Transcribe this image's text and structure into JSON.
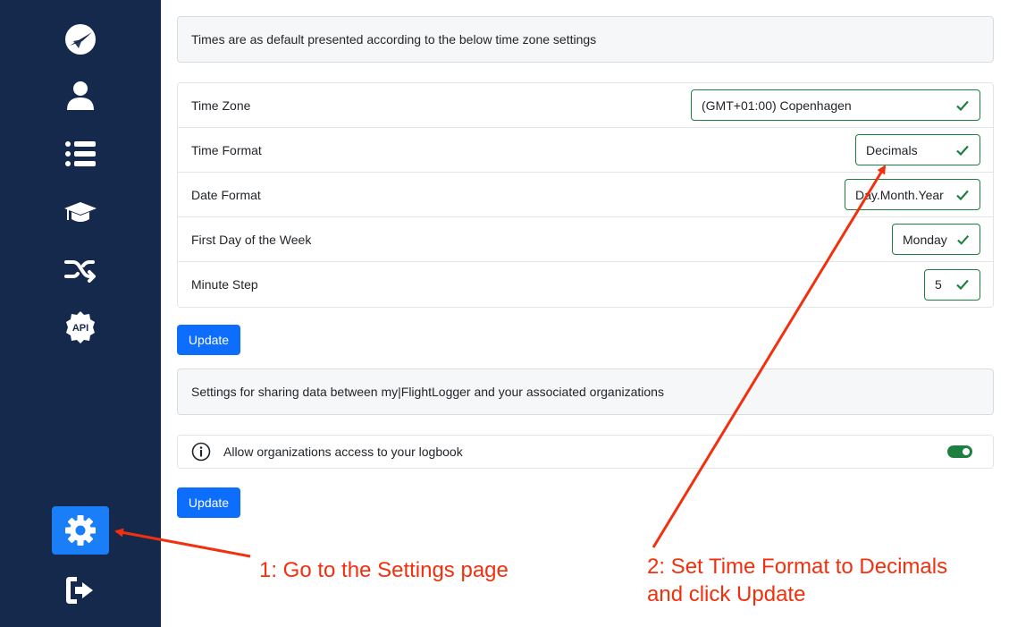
{
  "sidebar": {
    "items": [
      {
        "icon": "plane-logo-icon"
      },
      {
        "icon": "user-icon"
      },
      {
        "icon": "list-icon"
      },
      {
        "icon": "graduation-cap-icon"
      },
      {
        "icon": "shuffle-icon"
      },
      {
        "icon": "api-icon",
        "label": "API"
      },
      {
        "icon": "gear-icon",
        "active": true
      },
      {
        "icon": "sign-out-icon"
      }
    ],
    "active_color": "#1a7ef8",
    "background": "#14294b"
  },
  "timezone_section": {
    "description": "Times are as default presented according to the below time zone settings",
    "rows": [
      {
        "label": "Time Zone",
        "value": "(GMT+01:00) Copenhagen"
      },
      {
        "label": "Time Format",
        "value": "Decimals"
      },
      {
        "label": "Date Format",
        "value": "Day.Month.Year"
      },
      {
        "label": "First Day of the Week",
        "value": "Monday"
      },
      {
        "label": "Minute Step",
        "value": "5"
      }
    ],
    "update_label": "Update"
  },
  "sharing_section": {
    "description": "Settings for sharing data between my|FlightLogger and your associated organizations",
    "toggle_label": "Allow organizations access to your logbook",
    "toggle_on": true,
    "update_label": "Update"
  },
  "annotations": {
    "step1": "1: Go to the Settings page",
    "step2_line1": "2: Set Time Format to Decimals",
    "step2_line2": "and click Update",
    "color": "#f2300e"
  }
}
